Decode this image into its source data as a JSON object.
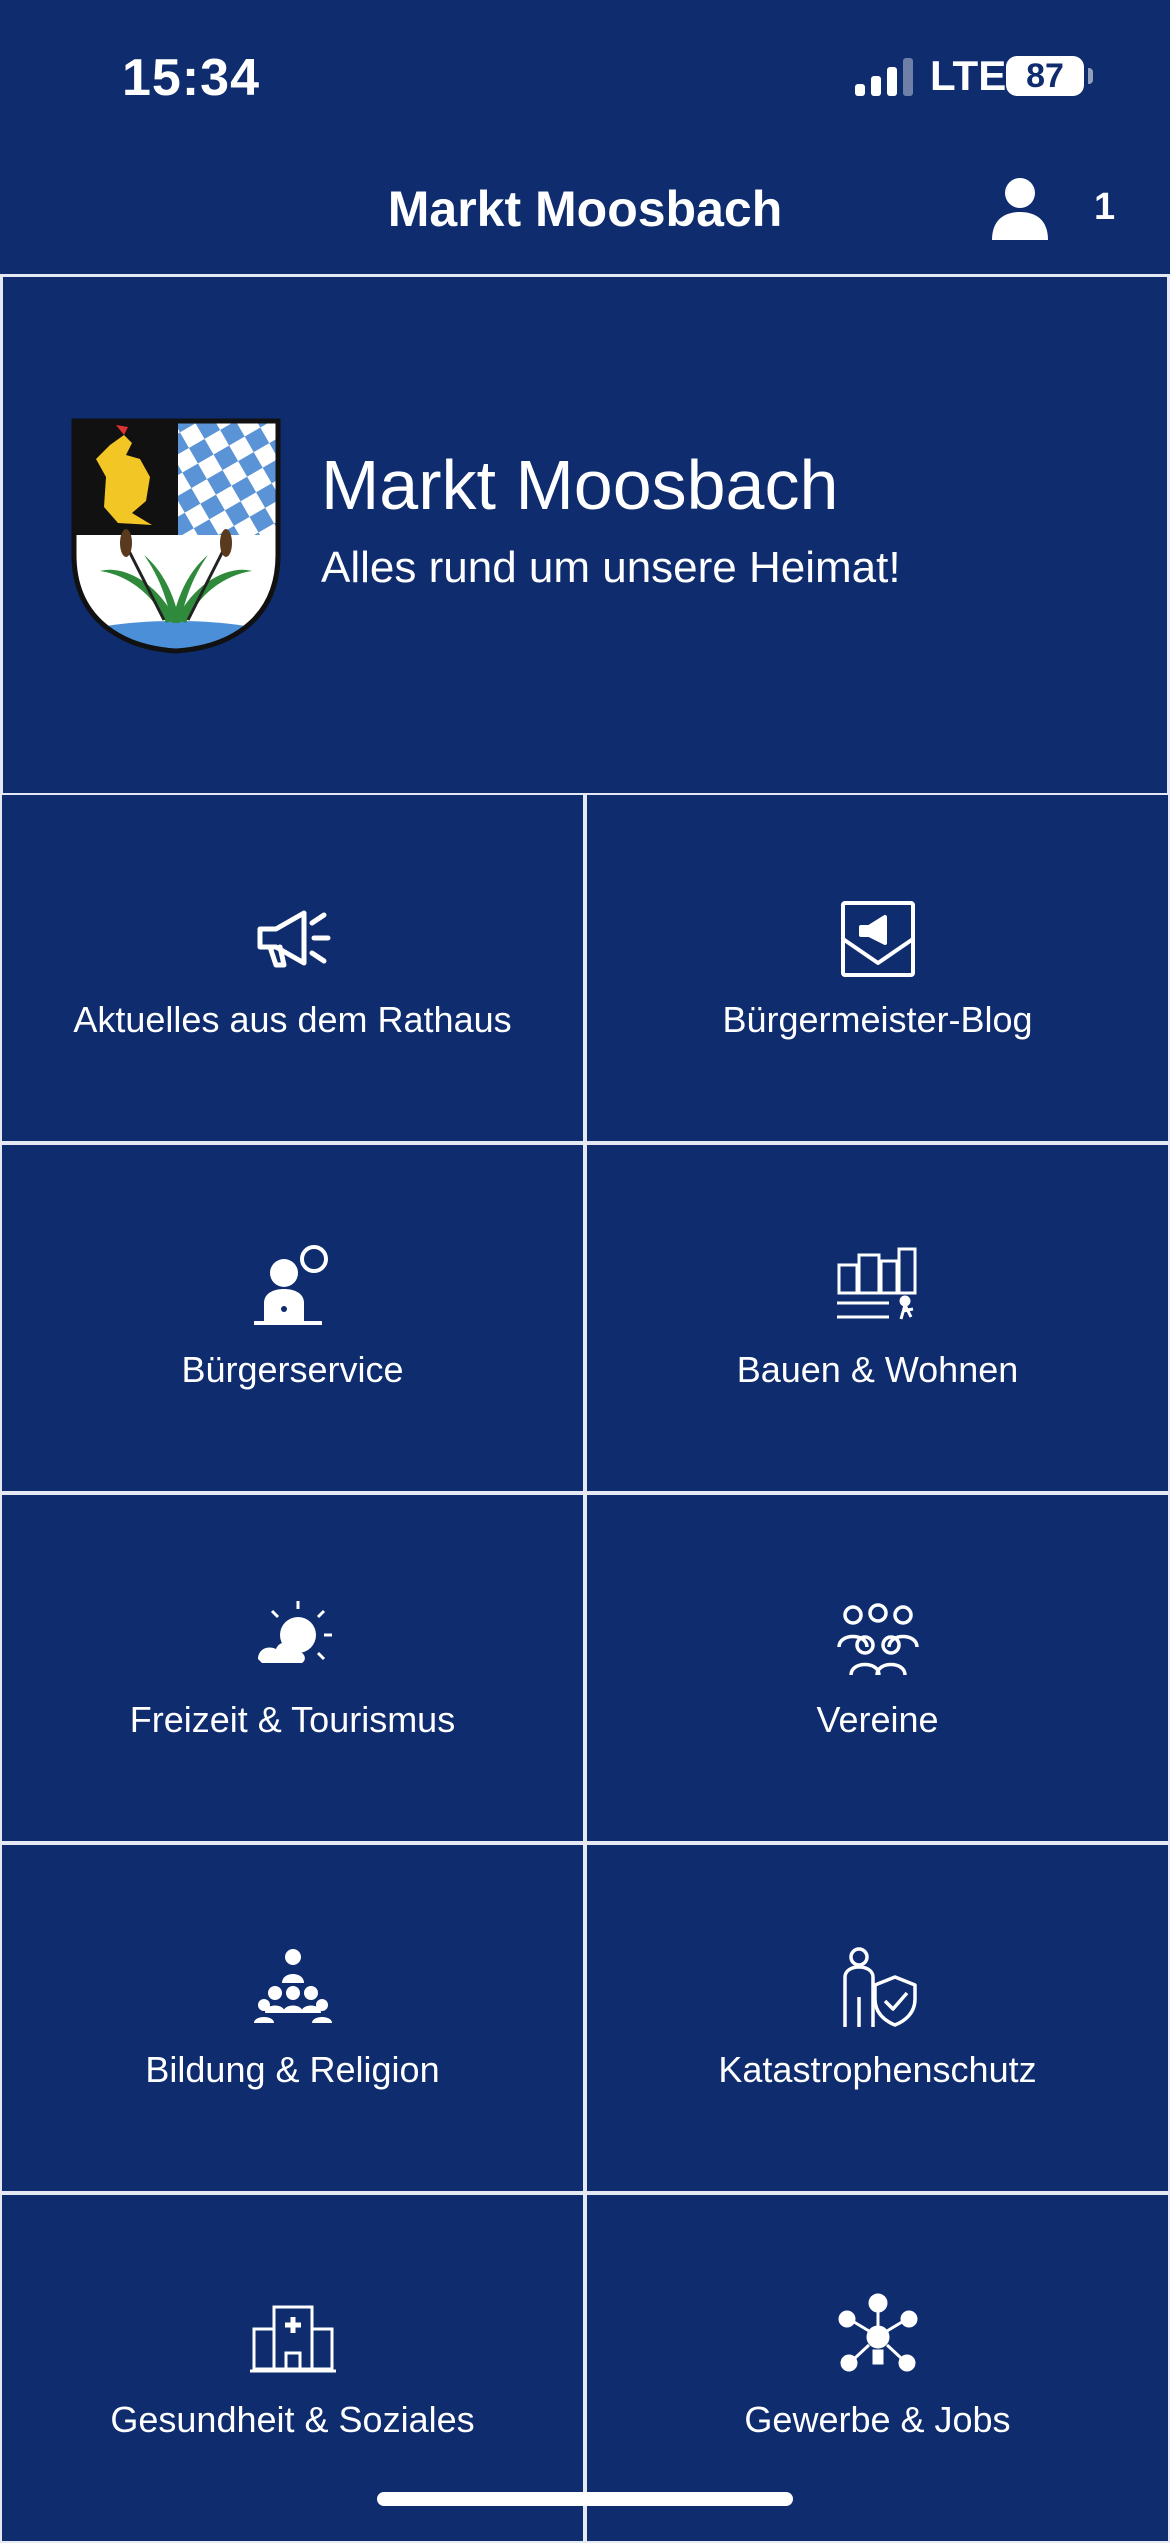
{
  "status_bar": {
    "time": "15:34",
    "network": "LTE",
    "battery": "87"
  },
  "header": {
    "title": "Markt Moosbach",
    "notification_count": "1"
  },
  "hero": {
    "title": "Markt Moosbach",
    "subtitle": "Alles rund um unsere Heimat!"
  },
  "tiles": [
    {
      "label": "Aktuelles aus dem Rathaus",
      "icon": "megaphone-icon"
    },
    {
      "label": "Bürgermeister-Blog",
      "icon": "envelope-megaphone-icon"
    },
    {
      "label": "Bürgerservice",
      "icon": "service-desk-icon"
    },
    {
      "label": "Bauen & Wohnen",
      "icon": "city-buildings-icon"
    },
    {
      "label": "Freizeit & Tourismus",
      "icon": "sun-cloud-icon"
    },
    {
      "label": "Vereine",
      "icon": "group-people-icon"
    },
    {
      "label": "Bildung & Religion",
      "icon": "teacher-students-icon"
    },
    {
      "label": "Katastrophenschutz",
      "icon": "person-shield-icon"
    },
    {
      "label": "Gesundheit & Soziales",
      "icon": "hospital-icon"
    },
    {
      "label": "Gewerbe & Jobs",
      "icon": "business-network-icon"
    }
  ],
  "colors": {
    "background": "#0e2c6e",
    "divider": "#e4e9f3",
    "text": "#ffffff"
  }
}
